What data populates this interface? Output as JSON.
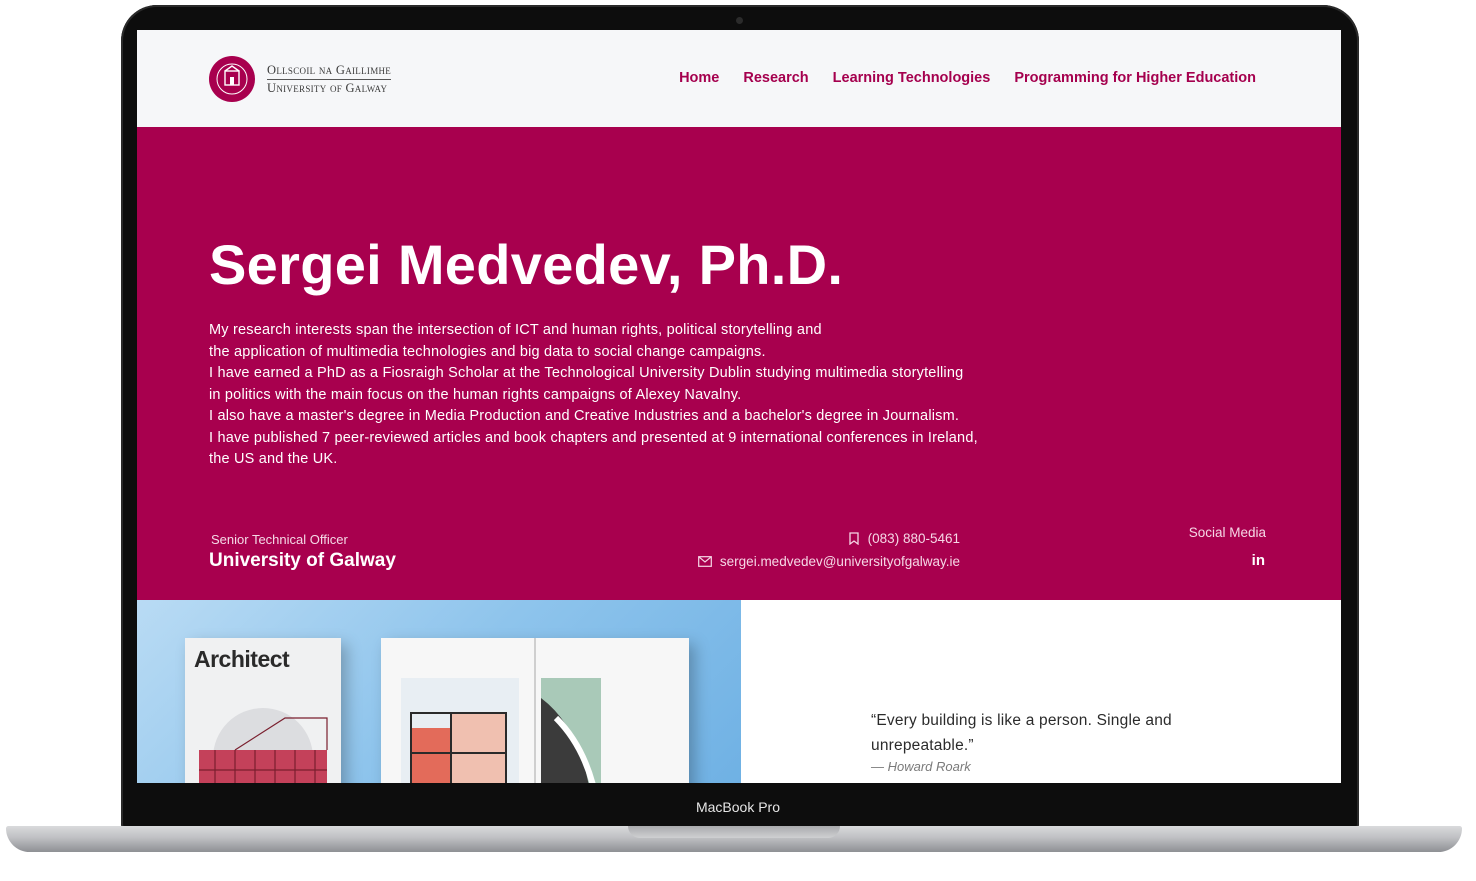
{
  "device": {
    "label": "MacBook Pro"
  },
  "header": {
    "logo": {
      "line1": "Ollscoil na Gaillimhe",
      "line2": "University of Galway",
      "seal_text": "GAILLIMH GALWAY"
    },
    "nav": [
      "Home",
      "Research",
      "Learning Technologies",
      "Programming for Higher Education"
    ]
  },
  "hero": {
    "name": "Sergei Medvedev, Ph.D.",
    "bio": [
      "My research interests span the intersection of ICT and human rights, political storytelling and",
      "the application of multimedia technologies and big data to social change campaigns.",
      "I have earned a PhD as a Fiosraigh Scholar at the Technological University Dublin studying multimedia storytelling",
      "in politics with the main focus on the human rights campaigns of Alexey Navalny.",
      "I also have a master's degree in Media Production and Creative Industries and a bachelor's degree in Journalism.",
      "I have published 7 peer-reviewed articles and book chapters and presented at 9 international conferences in Ireland,",
      "the US and the UK."
    ],
    "role": "Senior Technical Officer",
    "organization": "University of Galway",
    "phone": "(083) 880-5461",
    "email": "sergei.medvedev@universityofgalway.ie",
    "social_title": "Social Media",
    "social_link": "in"
  },
  "showcase": {
    "magazine_title": "Architect",
    "quote": "“Every building is like a person. Single and unrepeatable.”",
    "author": "— Howard Roark"
  },
  "colors": {
    "brand": "#a8004e",
    "header_bg": "#f6f7f9",
    "nav_text": "#a5004e"
  },
  "icons": {
    "phone": "phone-icon",
    "email": "mail-icon",
    "social": "linkedin-icon"
  }
}
